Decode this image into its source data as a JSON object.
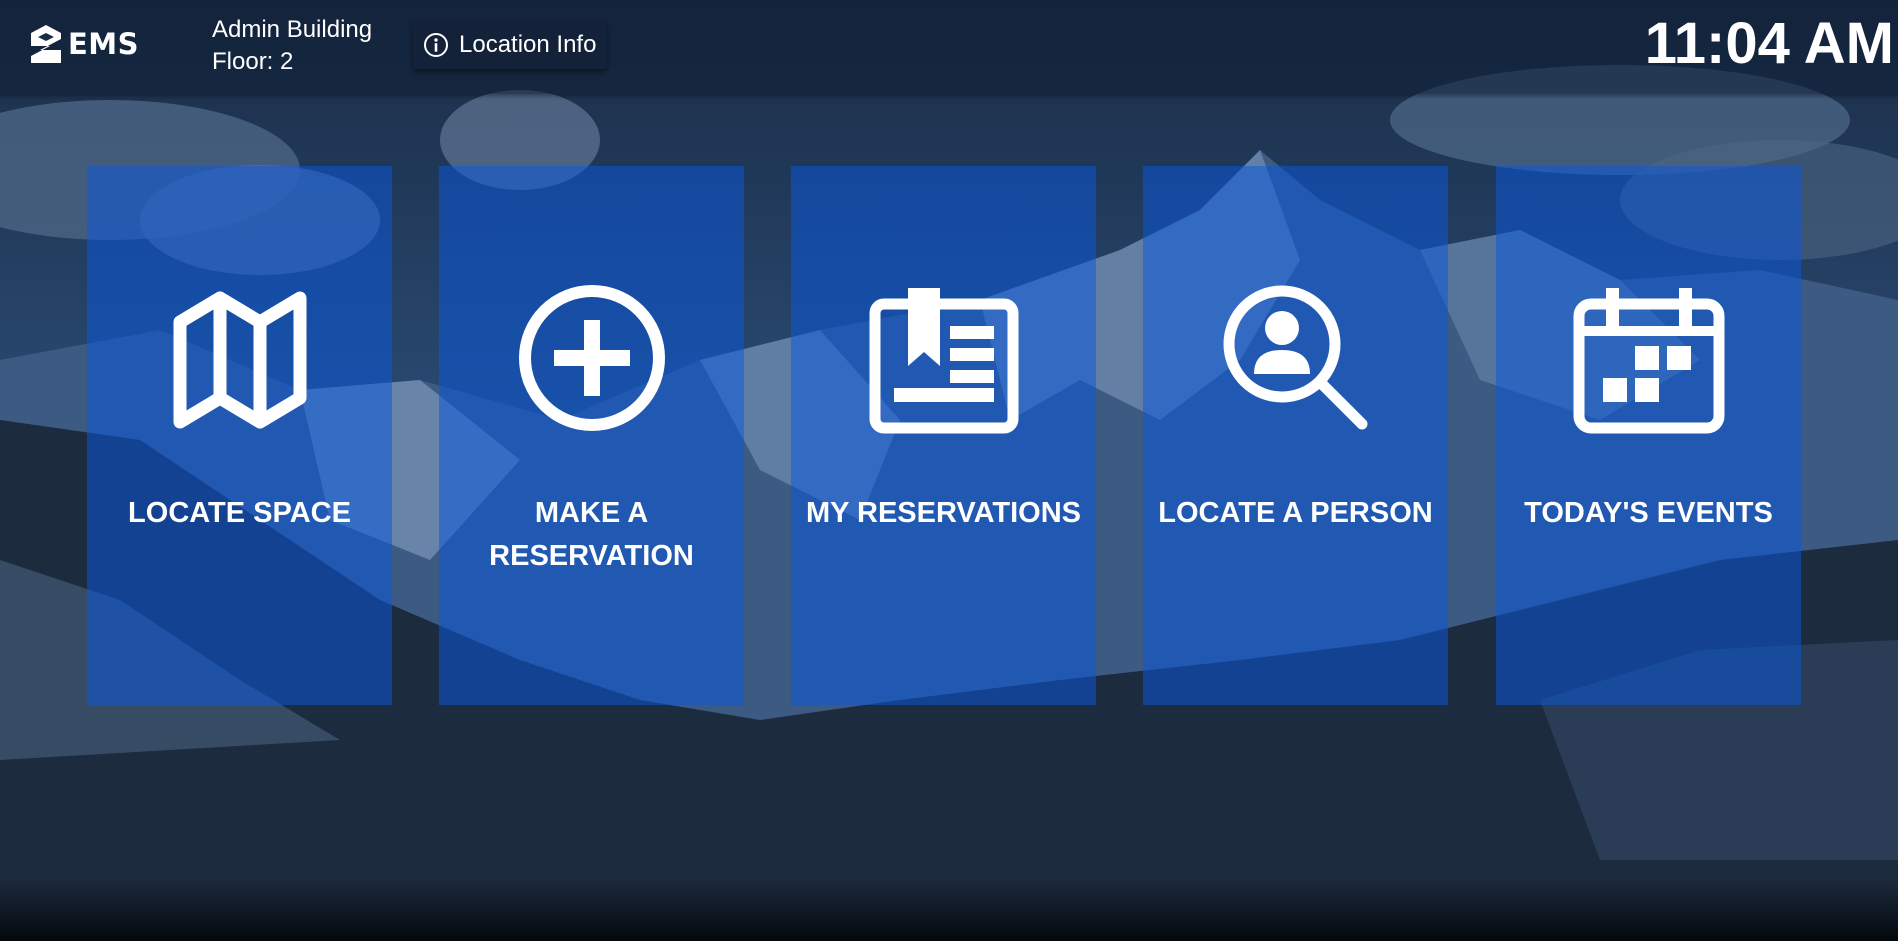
{
  "header": {
    "logo": {
      "icon": "ems-logo-icon",
      "text": "EMS"
    },
    "location": {
      "building": "Admin Building",
      "floor": "Floor: 2"
    },
    "location_info_button": {
      "icon": "info-icon",
      "label": "Location Info"
    },
    "clock": "11:04 AM"
  },
  "tiles": [
    {
      "icon": "map-icon",
      "label": "LOCATE SPACE"
    },
    {
      "icon": "plus-circle-icon",
      "label": "MAKE A RESERVATION"
    },
    {
      "icon": "reservation-book-icon",
      "label": "MY RESERVATIONS"
    },
    {
      "icon": "search-person-icon",
      "label": "LOCATE A PERSON"
    },
    {
      "icon": "calendar-icon",
      "label": "TODAY'S EVENTS"
    }
  ],
  "colors": {
    "tile": "#0a58de",
    "text": "#ffffff",
    "topbar": "#0e1e34"
  }
}
